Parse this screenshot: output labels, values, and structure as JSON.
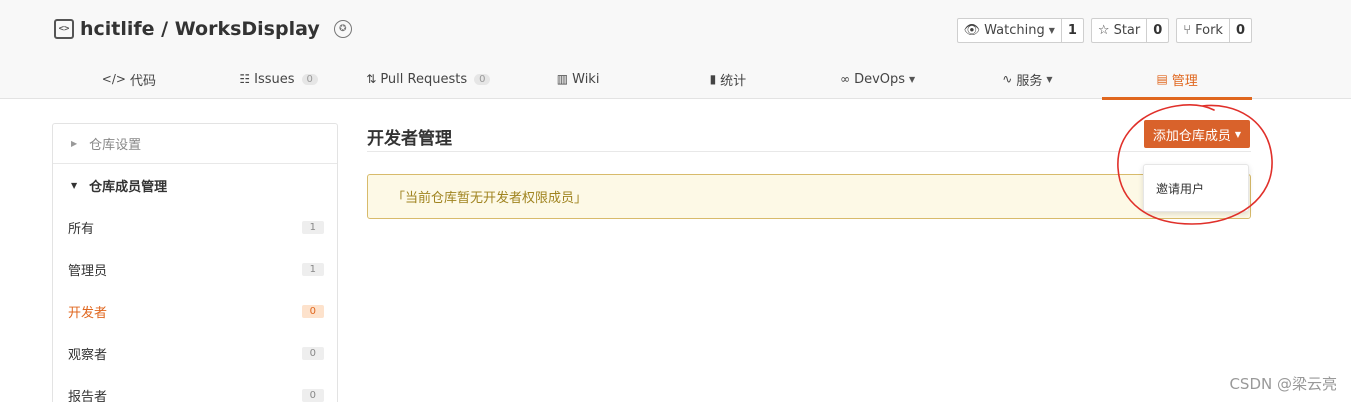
{
  "repo": {
    "owner": "hcitlife",
    "separator": " / ",
    "name": "WorksDisplay"
  },
  "actions": {
    "watch": {
      "label": "Watching",
      "count": "1"
    },
    "star": {
      "label": "Star",
      "count": "0"
    },
    "fork": {
      "label": "Fork",
      "count": "0"
    }
  },
  "nav": {
    "code": "代码",
    "issues": "Issues",
    "issues_count": "0",
    "pulls": "Pull Requests",
    "pulls_count": "0",
    "wiki": "Wiki",
    "stats": "统计",
    "devops": "DevOps",
    "services": "服务",
    "manage": "管理"
  },
  "sidebar": {
    "repo_settings": "仓库设置",
    "member_management": "仓库成员管理",
    "items": [
      {
        "label": "所有",
        "count": "1"
      },
      {
        "label": "管理员",
        "count": "1"
      },
      {
        "label": "开发者",
        "count": "0"
      },
      {
        "label": "观察者",
        "count": "0"
      },
      {
        "label": "报告者",
        "count": "0"
      }
    ]
  },
  "main": {
    "title": "开发者管理",
    "add_member_button": "添加仓库成员",
    "notice": "「当前仓库暂无开发者权限成员」",
    "dropdown_item": "邀请用户"
  },
  "watermark": "CSDN @梁云亮",
  "colors": {
    "accent": "#e0671f",
    "button": "#d9622b",
    "annotation": "#e0302a"
  }
}
